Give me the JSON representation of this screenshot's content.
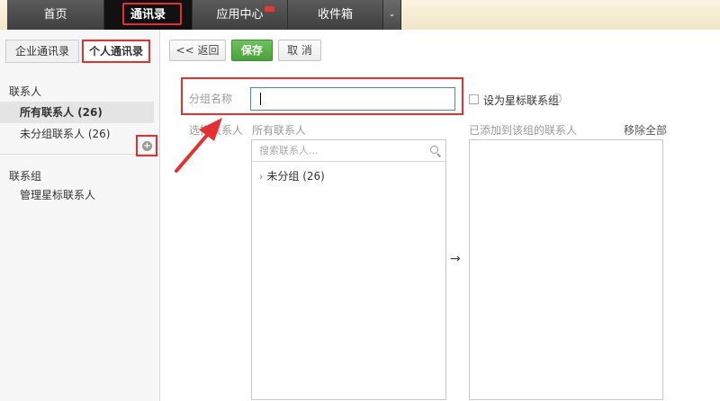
{
  "topnav": {
    "tabs": [
      {
        "label": "首页"
      },
      {
        "label": "通讯录"
      },
      {
        "label": "应用中心"
      },
      {
        "label": "收件箱"
      }
    ],
    "more_icon": "chevron-down-icon"
  },
  "sidebar": {
    "tabs": [
      {
        "label": "企业通讯录"
      },
      {
        "label": "个人通讯录"
      }
    ],
    "contacts_title": "联系人",
    "contact_items": [
      {
        "label": "所有联系人 (26)"
      },
      {
        "label": "未分组联系人 (26)"
      }
    ],
    "groups_title": "联系组",
    "group_items": [
      {
        "label": "管理星标联系人"
      }
    ]
  },
  "toolbar": {
    "back_label": "<< 返回",
    "save_label": "保存",
    "cancel_label": "取 消"
  },
  "form": {
    "group_name_label": "分组名称",
    "group_name_value": "",
    "star_label": "设为星标联系组",
    "star_checked": false,
    "select_contacts_label": "选择联系人",
    "all_contacts_label": "所有联系人",
    "search_placeholder": "搜索联系人...",
    "tree_items": [
      {
        "label": "未分组 (26)"
      }
    ],
    "added_label": "已添加到该组的联系人",
    "remove_all_label": "移除全部"
  },
  "colors": {
    "accent_red": "#e53030",
    "save_green": "#4aa23a",
    "nav_dark": "#3f3f3f",
    "input_focus": "#4a86d8"
  }
}
